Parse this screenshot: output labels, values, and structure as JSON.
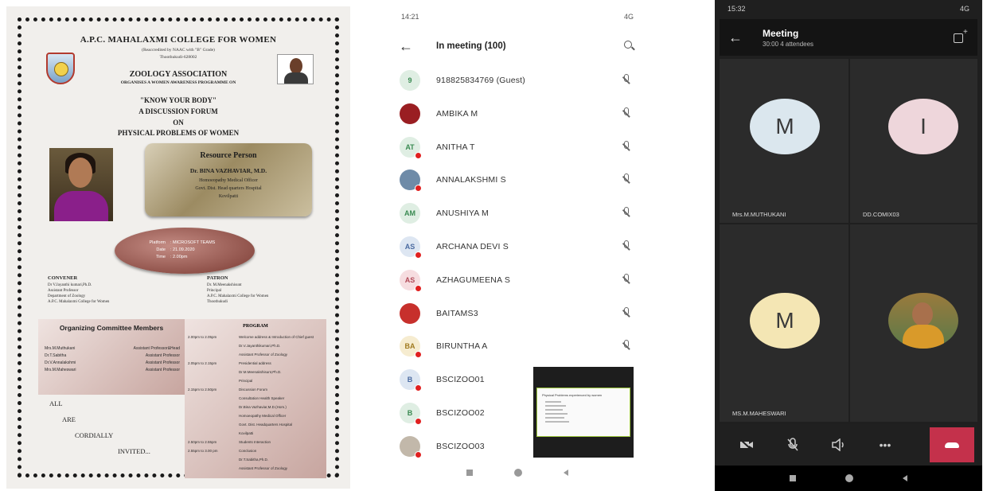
{
  "poster": {
    "college": "A.P.C. MAHALAXMI COLLEGE FOR WOMEN",
    "accredited": "(Reaccredited by NAAC with \"B\" Grade)",
    "city": "Thoothukudi-628002",
    "association": "ZOOLOGY ASSOCIATION",
    "organises": "ORGANISES A WOMEN AWARENESS PROGRAMME ON",
    "topic1": "\"KNOW YOUR BODY\"",
    "topic2": "A DISCUSSION FORUM",
    "topic3": "ON",
    "topic4": "PHYSICAL PROBLEMS OF WOMEN",
    "resource_title": "Resource Person",
    "resource_name": "Dr. BINA VAZHAVIAR, M.D.",
    "resource_role": "Homoeopathy Medical Officer",
    "resource_place": "Govt. Dist. Head quarters Hospital",
    "resource_city": "Kovilpatti",
    "platform_k": "Platform",
    "platform_v": ": MICROSOFT TEAMS",
    "date_k": "Date",
    "date_v": ": 21.09.2020",
    "time_k": "Time",
    "time_v": ": 2.00pm",
    "convener_head": "CONVENER",
    "convener_lines": [
      "Dr V.Jayanthi kumari,Ph.D.",
      "Assistant Professor",
      "Department of Zoology",
      "A.P.C. Mahalaxmi College for Women"
    ],
    "patron_head": "PATRON",
    "patron_lines": [
      "Dr. M.Meenakshisunt",
      "Principal",
      "A.P.C. Mahalaxmi College for Women",
      "Thoothukudi"
    ],
    "committee_title": "Organizing Committee Members",
    "committee": [
      {
        "name": "Mrs.M.Muthukani",
        "role": "Assistant Professor&Head"
      },
      {
        "name": "Dr.T.Sabitha",
        "role": "Assistant Professor"
      },
      {
        "name": "Dr.V.Annalakshmi",
        "role": "Assistant Professor"
      },
      {
        "name": "Mrs.M.Maheswari",
        "role": "Assistant Professor"
      }
    ],
    "program_title": "PROGRAM",
    "program": [
      {
        "time": "2.00pm to 2.05pm",
        "desc": "Welcome address & Introduction of Chief guest"
      },
      {
        "time": "",
        "desc": "Dr.V.Jayanthikumari,Ph.D."
      },
      {
        "time": "",
        "desc": "Assistant Professor of Zoology"
      },
      {
        "time": "2.05pm to 2.15pm",
        "desc": "Presidential address"
      },
      {
        "time": "",
        "desc": "Dr.M.Meenakshisunt,Ph.D."
      },
      {
        "time": "",
        "desc": "Principal"
      },
      {
        "time": "2.15pm to 2.50pm",
        "desc": "Discussion Forum"
      },
      {
        "time": "",
        "desc": "Consultation Health Speaker"
      },
      {
        "time": "",
        "desc": "Dr.Bina Vazhaviar,M.D.(Hom.)"
      },
      {
        "time": "",
        "desc": "Homoeopathy Medical Officer"
      },
      {
        "time": "",
        "desc": "Govt. Dist. Headquarters Hospital"
      },
      {
        "time": "",
        "desc": "Kovilpatti"
      },
      {
        "time": "2.50pm to 2.55pm",
        "desc": "Students Interaction"
      },
      {
        "time": "2.55pm to 3.00 pm",
        "desc": "Conclusion"
      },
      {
        "time": "",
        "desc": "Dr.T.Sabitha,Ph.D."
      },
      {
        "time": "",
        "desc": "Assistant Professor of Zoology"
      }
    ],
    "all": "ALL",
    "are": "ARE",
    "cordially": "CORDIALLY",
    "invited": "INVITED..."
  },
  "participants_screen": {
    "time": "14:21",
    "status_right": "4G",
    "title": "In meeting (100)",
    "participants": [
      {
        "initials": "9",
        "name": "918825834769 (Guest)",
        "bg": "#dfeee3",
        "fg": "#3a8a52",
        "dot": false
      },
      {
        "initials": "",
        "name": "AMBIKA M",
        "bg": "#9a1e22",
        "fg": "#ffffff",
        "dot": false,
        "photo": true
      },
      {
        "initials": "AT",
        "name": "ANITHA T",
        "bg": "#dfeee3",
        "fg": "#3a8a52",
        "dot": true
      },
      {
        "initials": "",
        "name": "ANNALAKSHMI S",
        "bg": "#6e8ba8",
        "fg": "#ffffff",
        "dot": true,
        "photo": true
      },
      {
        "initials": "AM",
        "name": "ANUSHIYA M",
        "bg": "#dfeee3",
        "fg": "#3a8a52",
        "dot": false
      },
      {
        "initials": "AS",
        "name": "ARCHANA DEVI S",
        "bg": "#dde6f2",
        "fg": "#4a6aa0",
        "dot": true
      },
      {
        "initials": "AS",
        "name": "AZHAGUMEENA S",
        "bg": "#f6dde0",
        "fg": "#b24a58",
        "dot": true
      },
      {
        "initials": "",
        "name": "BAITAMS3",
        "bg": "#c7302c",
        "fg": "#ffffff",
        "dot": false,
        "photo": true
      },
      {
        "initials": "BA",
        "name": "BIRUNTHA A",
        "bg": "#f6ecd0",
        "fg": "#a07a20",
        "dot": true
      },
      {
        "initials": "B",
        "name": "BSCIZOO01",
        "bg": "#dde6f2",
        "fg": "#4a6aa0",
        "dot": true
      },
      {
        "initials": "B",
        "name": "BSCIZOO02",
        "bg": "#dfeee3",
        "fg": "#3a8a52",
        "dot": true
      },
      {
        "initials": "",
        "name": "BSCIZOO03",
        "bg": "#c2b8aa",
        "fg": "#ffffff",
        "dot": true,
        "photo": true
      }
    ],
    "shared_doc_title": "Physical Problems experienced by women"
  },
  "meeting_screen": {
    "time": "15:32",
    "status_right": "4G",
    "title": "Meeting",
    "subtitle": "30:00  4 attendees",
    "tiles": [
      {
        "initial": "M",
        "label": "Mrs.M.MUTHUKANI",
        "color": "#dbe7ee"
      },
      {
        "initial": "I",
        "label": "DD.COMIX03",
        "color": "#eed6db"
      },
      {
        "initial": "M",
        "label": "MS.M.MAHESWARI",
        "color": "#f4e6b4"
      },
      {
        "initial": "",
        "label": "",
        "color": "#5a8a5a",
        "photo": true
      }
    ],
    "controls": [
      "camera-off",
      "mic-off",
      "speaker",
      "more",
      "hang-up"
    ],
    "accent": "#c4314b"
  }
}
